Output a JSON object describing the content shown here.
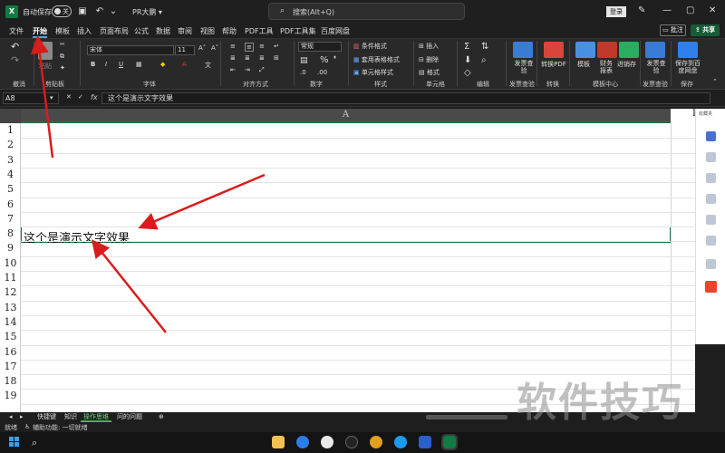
{
  "titlebar": {
    "app_icon": "X",
    "autosave_label": "自动保存",
    "toggle_state": "关",
    "doc_name": "PR大鹏",
    "search_placeholder": "搜索(Alt+Q)",
    "signin": "登录"
  },
  "menu": {
    "items": [
      "文件",
      "开始",
      "模板",
      "插入",
      "页面布局",
      "公式",
      "数据",
      "审阅",
      "视图",
      "帮助",
      "PDF工具",
      "PDF工具集",
      "百度网盘"
    ],
    "active": "开始",
    "comments": "批注",
    "share": "共享"
  },
  "ribbon": {
    "font_name": "宋体",
    "font_size": "11",
    "number_format": "常规",
    "paste": "粘贴",
    "cond_format": "条件格式",
    "table_format": "套用表格格式",
    "cell_style": "单元格样式",
    "insert": "插入",
    "delete": "删除",
    "format": "格式",
    "big_buttons": [
      "发票查验",
      "转换PDF",
      "模板",
      "财务报表",
      "进销存",
      "发票查验",
      "保存到百度网盘"
    ],
    "group_labels": [
      "撤消",
      "剪贴板",
      "字体",
      "对齐方式",
      "数字",
      "样式",
      "单元格",
      "编辑",
      "发票查验",
      "转换",
      "模板中心",
      "发票查验",
      "保存"
    ]
  },
  "formula_bar": {
    "name_box": "A8",
    "fx": "fx",
    "content": "这个是演示文字效果"
  },
  "grid": {
    "column_header": "A",
    "next_column": "I",
    "rows": [
      "1",
      "2",
      "3",
      "4",
      "5",
      "6",
      "7",
      "8",
      "9",
      "10",
      "11",
      "12",
      "13",
      "14",
      "15",
      "16",
      "17",
      "18",
      "19"
    ],
    "cell_a8": "这个是演示文字效果"
  },
  "right_panel": {
    "top_label": "收藏夹"
  },
  "sheets": {
    "tabs": [
      "快捷键",
      "知识",
      "操作思维",
      "问的问题"
    ],
    "active": "操作思维"
  },
  "status": {
    "ready": "就绪",
    "accessibility": "辅助功能: 一切就绪"
  },
  "watermark": "软件技巧",
  "colors": {
    "accent_green": "#1e7145",
    "arrow_red": "#d91c1c",
    "share_green": "#185c37"
  }
}
